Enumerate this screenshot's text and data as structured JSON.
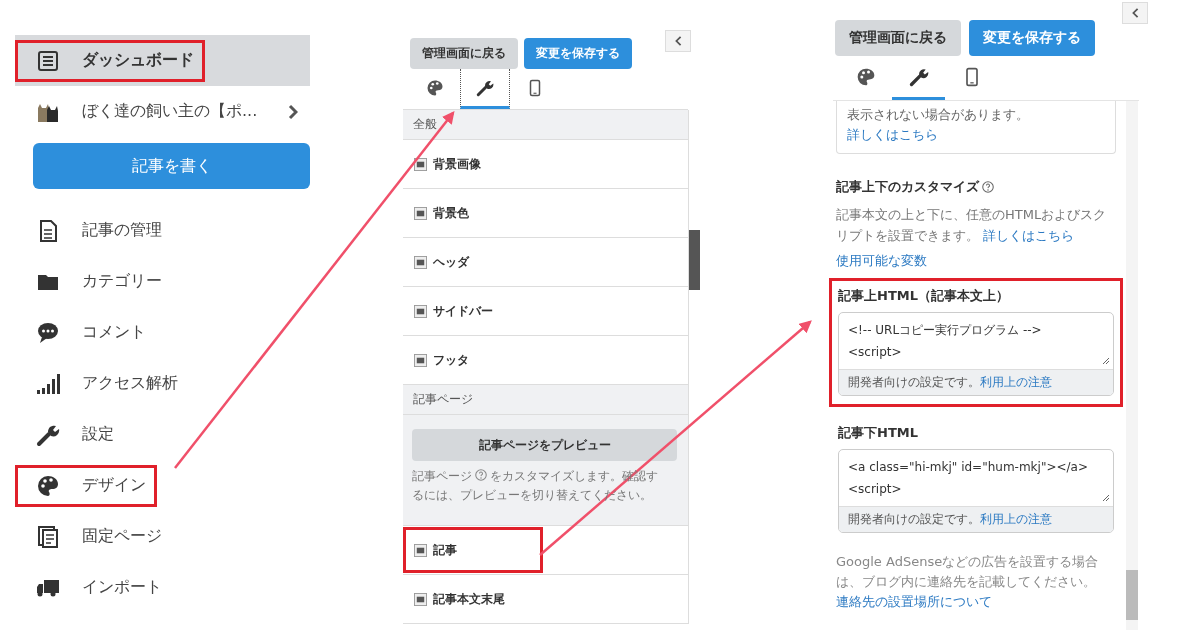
{
  "sidebar": {
    "items": [
      {
        "kind": "link",
        "label": "ダッシュボード",
        "selected": true,
        "highlighted": true
      },
      {
        "kind": "blog",
        "label": "ぼく達の飼い主の【ポ...",
        "selected": false,
        "highlighted": false
      },
      {
        "kind": "button",
        "label": "記事を書く"
      },
      {
        "kind": "link",
        "label": "記事の管理",
        "selected": false,
        "highlighted": false
      },
      {
        "kind": "link",
        "label": "カテゴリー",
        "selected": false,
        "highlighted": false
      },
      {
        "kind": "link",
        "label": "コメント",
        "selected": false,
        "highlighted": false
      },
      {
        "kind": "link",
        "label": "アクセス解析",
        "selected": false,
        "highlighted": false
      },
      {
        "kind": "link",
        "label": "設定",
        "selected": false,
        "highlighted": false
      },
      {
        "kind": "link",
        "label": "デザイン",
        "selected": false,
        "highlighted": true
      },
      {
        "kind": "link",
        "label": "固定ページ",
        "selected": false,
        "highlighted": false
      },
      {
        "kind": "link",
        "label": "インポート",
        "selected": false,
        "highlighted": false
      }
    ]
  },
  "design_panel": {
    "back_button": "管理画面に戻る",
    "save_button": "変更を保存する",
    "tabs": [
      {
        "selected": false
      },
      {
        "selected": true
      },
      {
        "selected": false
      }
    ],
    "sections": [
      {
        "title": "全般",
        "items": [
          {
            "label": "背景画像",
            "highlighted": false
          },
          {
            "label": "背景色",
            "highlighted": false
          },
          {
            "label": "ヘッダ",
            "highlighted": false
          },
          {
            "label": "サイドバー",
            "highlighted": false
          },
          {
            "label": "フッタ",
            "highlighted": false
          }
        ]
      },
      {
        "title": "記事ページ",
        "preview_button": "記事ページをプレビュー",
        "description_before": "記事ページ",
        "description_after": "をカスタマイズします。確認す",
        "description_line2": "るには、プレビューを切り替えてください。",
        "items": [
          {
            "label": "記事",
            "highlighted": true
          },
          {
            "label": "記事本文末尾",
            "highlighted": false
          }
        ]
      }
    ]
  },
  "article_panel": {
    "back_button": "管理画面に戻る",
    "save_button": "変更を保存する",
    "tabs": [
      {
        "selected": false
      },
      {
        "selected": true
      },
      {
        "selected": false
      }
    ],
    "notice": {
      "text": "表示されない場合があります。",
      "link": "詳しくはこちら"
    },
    "heading": "記事上下のカスタマイズ",
    "description": "記事本文の上と下に、任意のHTMLおよびスクリプトを設置できます。",
    "description_link": "詳しくはこちら",
    "variables_link": "使用可能な変数",
    "fields": [
      {
        "label": "記事上HTML（記事本文上）",
        "highlighted": true,
        "lines": [
          "<!-- URLコピー実行プログラム -->",
          "<script>"
        ],
        "note": "開発者向けの設定です。",
        "note_link": "利用上の注意"
      },
      {
        "label": "記事下HTML",
        "highlighted": false,
        "lines": [
          "<a  class=\"hi-mkj\" id=\"hum-mkj\"></a>",
          "<script>"
        ],
        "note": "開発者向けの設定です。",
        "note_link": "利用上の注意"
      }
    ],
    "footer_text": "Google AdSenseなどの広告を設置する場合は、ブログ内に連絡先を記載してください。",
    "footer_link": "連絡先の設置場所について"
  }
}
